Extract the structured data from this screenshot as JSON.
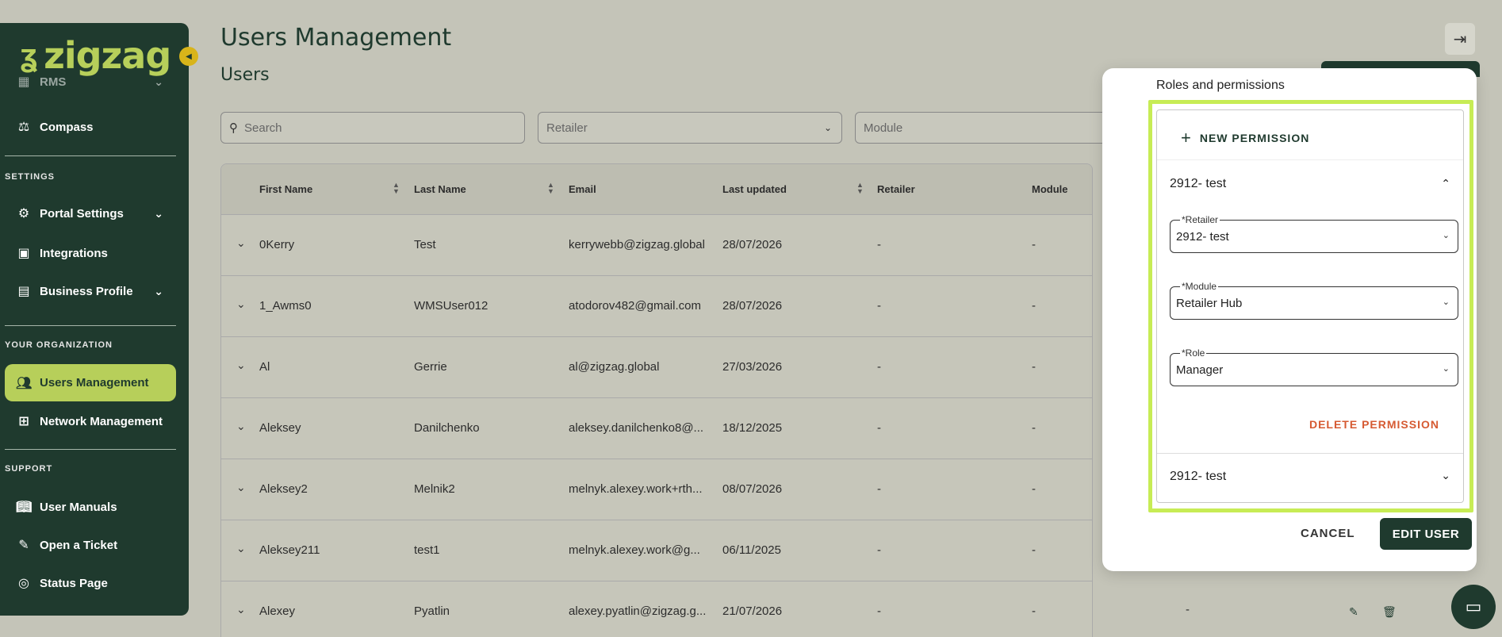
{
  "app": {
    "logo_text": "zigzag",
    "logo_mark": "ʓ"
  },
  "sidebar": {
    "items": [
      {
        "label": "RMS",
        "icon": "warehouse-icon"
      },
      {
        "label": "Compass",
        "icon": "scale-icon"
      }
    ],
    "settings_title": "SETTINGS",
    "settings_items": [
      {
        "label": "Portal Settings",
        "icon": "gear-icon"
      },
      {
        "label": "Integrations",
        "icon": "integrations-icon"
      },
      {
        "label": "Business Profile",
        "icon": "badge-icon"
      }
    ],
    "org_title": "YOUR ORGANIZATION",
    "org_items": [
      {
        "label": "Users Management",
        "icon": "users-icon"
      },
      {
        "label": "Network Management",
        "icon": "network-icon"
      }
    ],
    "support_title": "SUPPORT",
    "support_items": [
      {
        "label": "User Manuals",
        "icon": "book-icon"
      },
      {
        "label": "Open a Ticket",
        "icon": "ticket-icon"
      },
      {
        "label": "Status Page",
        "icon": "lifebuoy-icon"
      }
    ]
  },
  "header": {
    "title": "Users Management",
    "subtitle": "Users"
  },
  "filters": {
    "search_placeholder": "Search",
    "retailer_placeholder": "Retailer",
    "module_placeholder": "Module"
  },
  "table": {
    "columns": [
      "First Name",
      "Last Name",
      "Email",
      "Last updated",
      "Retailer",
      "Module"
    ],
    "rows": [
      {
        "first": "0Kerry",
        "last": "Test",
        "email": "kerrywebb@zigzag.global",
        "updated": "28/07/2026",
        "retailer": "-",
        "module": "-"
      },
      {
        "first": "1_Awms0",
        "last": "WMSUser012",
        "email": "atodorov482@gmail.com",
        "updated": "28/07/2026",
        "retailer": "-",
        "module": "-"
      },
      {
        "first": "Al",
        "last": "Gerrie",
        "email": "al@zigzag.global",
        "updated": "27/03/2026",
        "retailer": "-",
        "module": "-"
      },
      {
        "first": "Aleksey",
        "last": "Danilchenko",
        "email": "aleksey.danilchenko8@...",
        "updated": "18/12/2025",
        "retailer": "-",
        "module": "-"
      },
      {
        "first": "Aleksey2",
        "last": "Melnik2",
        "email": "melnyk.alexey.work+rth...",
        "updated": "08/07/2026",
        "retailer": "-",
        "module": "-"
      },
      {
        "first": "Aleksey211",
        "last": "test1",
        "email": "melnyk.alexey.work@g...",
        "updated": "06/11/2025",
        "retailer": "-",
        "module": "-"
      },
      {
        "first": "Alexey",
        "last": "Pyatlin",
        "email": "alexey.pyatlin@zigzag.g...",
        "updated": "21/07/2026",
        "retailer": "-",
        "module": "-",
        "extra": "-"
      }
    ]
  },
  "modal": {
    "section_label": "Roles and permissions",
    "new_permission": "NEW PERMISSION",
    "permission_1_title": "2912- test",
    "retailer_label": "*Retailer",
    "retailer_value": "2912- test",
    "module_label": "*Module",
    "module_value": "Retailer Hub",
    "role_label": "*Role",
    "role_value": "Manager",
    "delete_permission": "DELETE PERMISSION",
    "permission_2_title": "2912- test",
    "cancel": "CANCEL",
    "edit_user": "EDIT USER"
  },
  "colors": {
    "brand_dark": "#1f3a2e",
    "brand_lime": "#b7cf5a",
    "highlight": "#c7ec55",
    "danger": "#d65a32"
  }
}
